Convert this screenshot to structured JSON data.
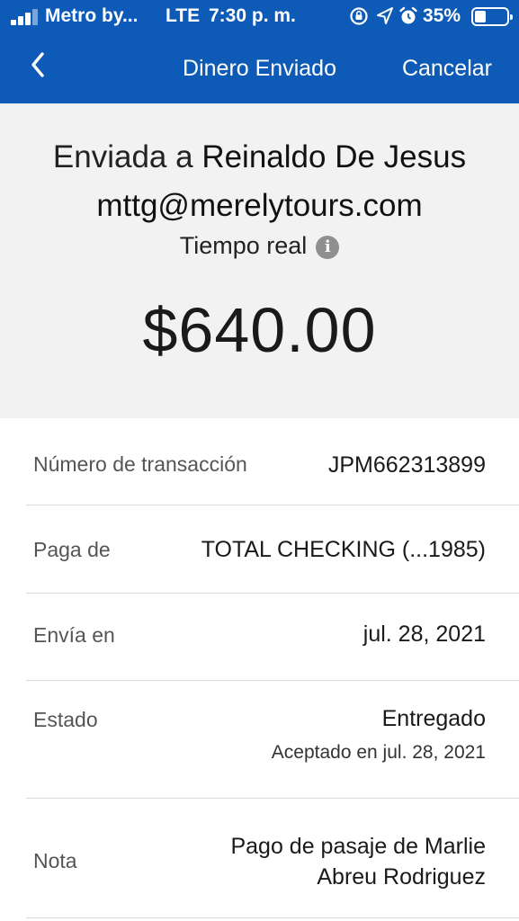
{
  "status_bar": {
    "carrier": "Metro by...",
    "network": "LTE",
    "time": "7:30 p. m.",
    "battery_percent": "35%",
    "battery_level": 0.35,
    "icons": [
      "signal-icon",
      "screen-rotation-lock-icon",
      "location-arrow-icon",
      "alarm-icon",
      "battery-icon"
    ]
  },
  "nav": {
    "back_icon": "chevron-left-icon",
    "title": "Dinero Enviado",
    "cancel_label": "Cancelar"
  },
  "summary": {
    "sent_to_prefix": "Enviada a",
    "recipient_name": "Reinaldo De Jesus",
    "recipient_email": "mttg@merelytours.com",
    "speed_label": "Tiempo real",
    "info_icon": "info-icon",
    "amount": "$640.00"
  },
  "details": [
    {
      "label": "Número de transacción",
      "value": "JPM662313899"
    },
    {
      "label": "Paga de",
      "value": "TOTAL CHECKING (...1985)"
    },
    {
      "label": "Envía en",
      "value": "jul. 28, 2021"
    },
    {
      "label": "Estado",
      "value": "Entregado",
      "sub": "Aceptado en jul. 28, 2021"
    },
    {
      "label": "Nota",
      "value_line1": "Pago de pasaje de Marlie",
      "value_line2": "Abreu Rodriguez"
    }
  ],
  "colors": {
    "header_blue": "#0d5bb6",
    "summary_bg": "#f2f2f2",
    "divider": "#dcdcdc"
  }
}
